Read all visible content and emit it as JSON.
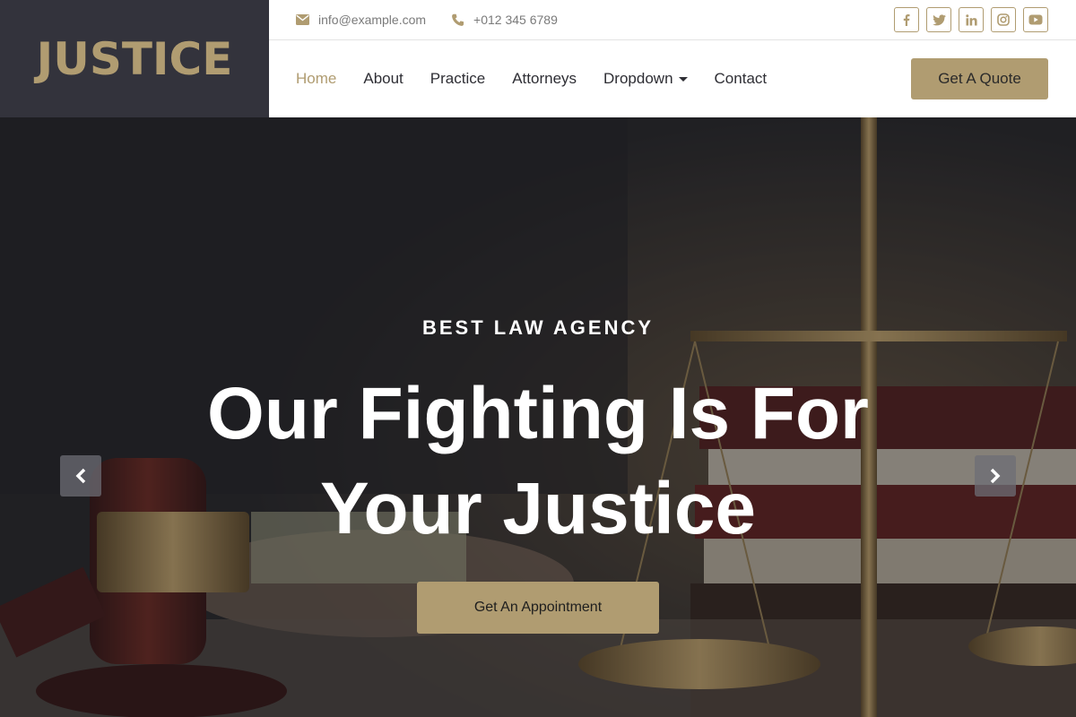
{
  "brand": {
    "name": "JUSTICE",
    "accent": "#b09c71",
    "dark": "#33333c"
  },
  "topbar": {
    "email": "info@example.com",
    "phone": "+012 345 6789",
    "socials": [
      "facebook-icon",
      "twitter-icon",
      "linkedin-icon",
      "instagram-icon",
      "youtube-icon"
    ]
  },
  "nav": {
    "items": [
      {
        "label": "Home",
        "active": true
      },
      {
        "label": "About"
      },
      {
        "label": "Practice"
      },
      {
        "label": "Attorneys"
      },
      {
        "label": "Dropdown",
        "has_dropdown": true
      },
      {
        "label": "Contact"
      }
    ],
    "cta_label": "Get A Quote"
  },
  "hero": {
    "eyebrow": "BEST LAW AGENCY",
    "title_line1": "Our Fighting Is For",
    "title_line2": "Your Justice",
    "cta_label": "Get An Appointment"
  },
  "carousel": {
    "prev_icon": "chevron-left-icon",
    "next_icon": "chevron-right-icon"
  }
}
